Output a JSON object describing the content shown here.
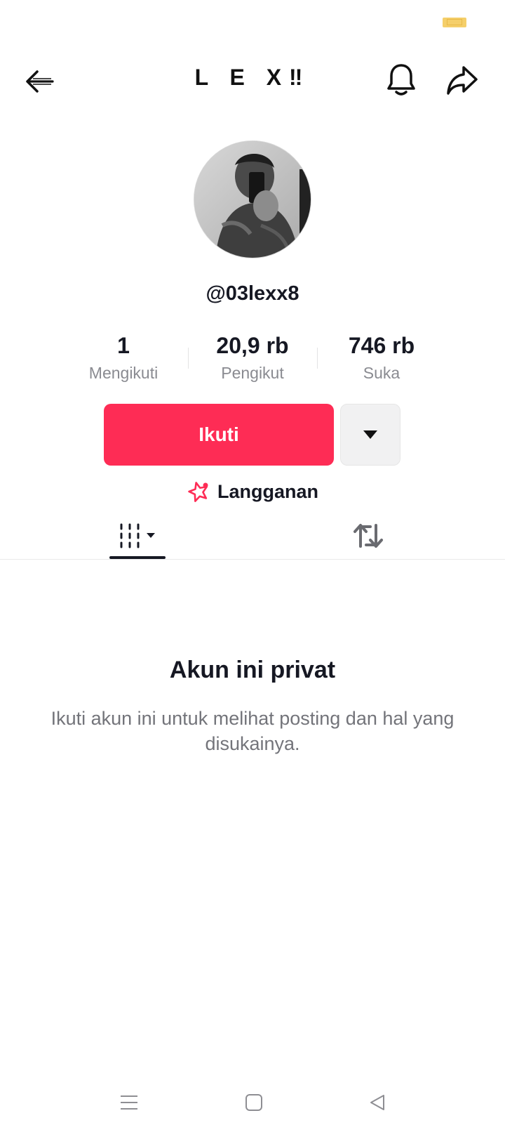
{
  "profile": {
    "title": "L E X‼",
    "username": "@03lexx8"
  },
  "stats": [
    {
      "value": "1",
      "label": "Mengikuti"
    },
    {
      "value": "20,9 rb",
      "label": "Pengikut"
    },
    {
      "value": "746 rb",
      "label": "Suka"
    }
  ],
  "actions": {
    "follow_label": "Ikuti",
    "subscription_label": "Langganan"
  },
  "private": {
    "title": "Akun ini privat",
    "description": "Ikuti akun ini untuk melihat posting dan hal yang disukainya."
  },
  "icons": {
    "back": "arrow-left-icon",
    "notifications": "bell-icon",
    "share": "share-arrow-icon",
    "more": "caret-down-icon",
    "subscription": "star-badge-icon",
    "videos_tab": "grid-icon",
    "reposts_tab": "repost-icon",
    "nav_menu": "menu-icon",
    "nav_home": "square-icon",
    "nav_back": "triangle-back-icon"
  },
  "colors": {
    "accent": "#fe2c55",
    "text": "#161823",
    "muted": "#8a8b91"
  }
}
